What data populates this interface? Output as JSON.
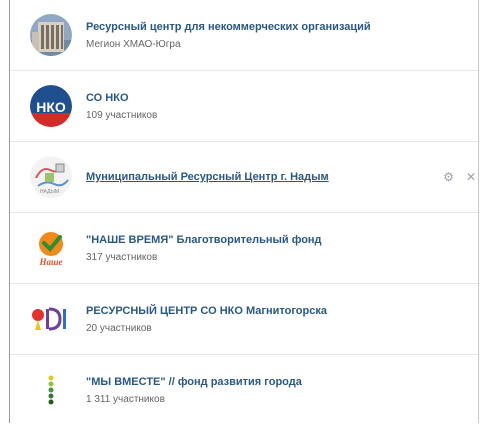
{
  "groups": [
    {
      "title": "Ресурсный центр для некоммерческих организаций",
      "subtitle": "Мегион ХМАО-Югра",
      "avatar_icon": "building-photo-icon"
    },
    {
      "title": "СО НКО",
      "subtitle": "109 участников",
      "avatar_icon": "nko-logo-icon"
    },
    {
      "title": "Муниципальный Ресурсный Центр г. Надым",
      "subtitle": "",
      "avatar_icon": "map-logo-icon",
      "actions": {
        "settings_icon": "gear-icon",
        "close_icon": "close-icon"
      }
    },
    {
      "title": "\"НАШЕ ВРЕМЯ\" Благотворительный фонд",
      "subtitle": "317 участников",
      "avatar_icon": "nashe-vremya-logo-icon"
    },
    {
      "title": "РЕСУРСНЫЙ ЦЕНТР СО НКО Магнитогорска",
      "subtitle": "20 участников",
      "avatar_icon": "odi-logo-icon"
    },
    {
      "title": "\"МЫ ВМЕСТЕ\" // фонд развития города",
      "subtitle": "1 311 участников",
      "avatar_icon": "dots-logo-icon"
    }
  ],
  "colors": {
    "link": "#2a5885",
    "muted": "#656565",
    "divider": "#e7e8ec",
    "icon": "#99a2ad"
  }
}
